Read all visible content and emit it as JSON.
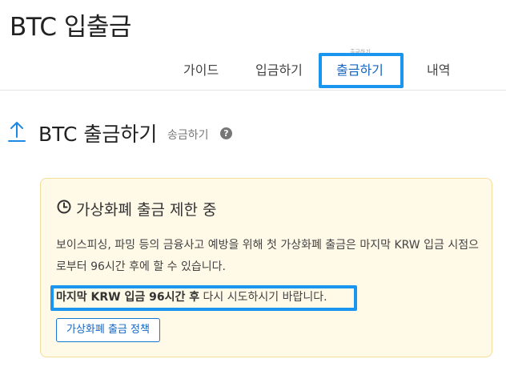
{
  "header": {
    "title": "BTC 입출금"
  },
  "tabs": [
    {
      "label": "가이드"
    },
    {
      "label": "입금하기"
    },
    {
      "label": "출금하기",
      "active": true
    },
    {
      "label": "내역"
    }
  ],
  "tab_tiny_text": "출금하기",
  "section": {
    "title": "BTC 출금하기",
    "subtitle": "송금하기",
    "help_icon": "?"
  },
  "notice": {
    "title": "가상화폐 출금 제한 중",
    "line1": "보이스피싱, 파밍 등의 금융사고 예방을 위해 첫 가상화폐 출금은 마지막 KRW 입금 시점으로부터 96시간 후에 할 수 있습니다.",
    "warn_bold": "마지막 KRW 입금 96시간 후",
    "warn_rest": " 다시 시도하시기 바랍니다.",
    "policy_button": "가상화폐 출금 정책"
  },
  "colors": {
    "accent": "#1565c0",
    "highlight": "#1a96f0",
    "notice_bg": "#fff9e8",
    "notice_border": "#f2dd9a"
  },
  "icons": [
    "arrow-up-icon",
    "help-circle-icon",
    "clock-icon"
  ]
}
